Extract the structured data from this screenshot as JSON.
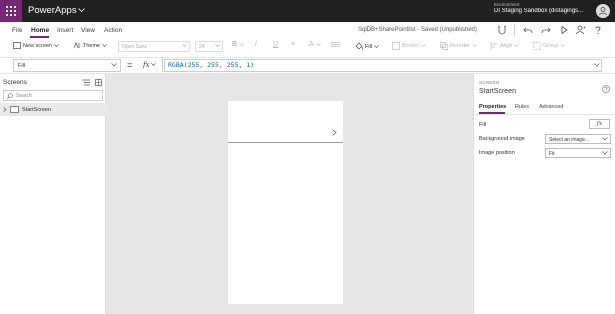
{
  "app": {
    "name": "PowerApps",
    "environment_label": "Environment",
    "environment_name": "DI Staging Sandbox (distagings..."
  },
  "menu": {
    "items": [
      "File",
      "Home",
      "Insert",
      "View",
      "Action"
    ],
    "active": "Home"
  },
  "document": {
    "title": "SqlDB+SharePointlist - Saved (Unpublished)"
  },
  "toolbar": {
    "new_screen": "New screen",
    "theme": "Theme",
    "font": "Open Sans",
    "font_size": "24",
    "bold": "B",
    "italic": "/",
    "underline": "U",
    "align": "≡",
    "font_color": "A",
    "fill": "Fill",
    "border": "Border",
    "reorder": "Reorder",
    "align_label": "Align",
    "group": "Group"
  },
  "formula_bar": {
    "property": "Fill",
    "equals": "=",
    "fx": "fx",
    "formula": "RGBA(255, 255, 255, 1)"
  },
  "left_panel": {
    "title": "Screens",
    "search_placeholder": "Search",
    "items": [
      {
        "label": "StartScreen"
      }
    ]
  },
  "right_panel": {
    "section_label": "SCREEN",
    "name": "StartScreen",
    "tabs": [
      "Properties",
      "Rules",
      "Advanced"
    ],
    "active_tab": "Properties",
    "properties": {
      "fill_label": "Fill",
      "fx_button": "fx",
      "background_image_label": "Background image",
      "background_image_value": "Select an image...",
      "image_position_label": "Image position",
      "image_position_value": "Fit"
    }
  },
  "colors": {
    "brand": "#742774",
    "topbar": "#212121",
    "canvas": "#e5e5e5",
    "formula_text": "#0b6a9e"
  },
  "icons": [
    "waffle-icon",
    "chevron-down-icon",
    "user-avatar-icon",
    "health-check-icon",
    "undo-icon",
    "redo-icon",
    "play-icon",
    "share-user-icon",
    "help-icon",
    "new-screen-icon",
    "theme-icon",
    "fill-bucket-icon",
    "search-icon",
    "tree-view-icon",
    "thumbnail-view-icon",
    "expand-chevron-icon",
    "chevron-right-icon"
  ]
}
